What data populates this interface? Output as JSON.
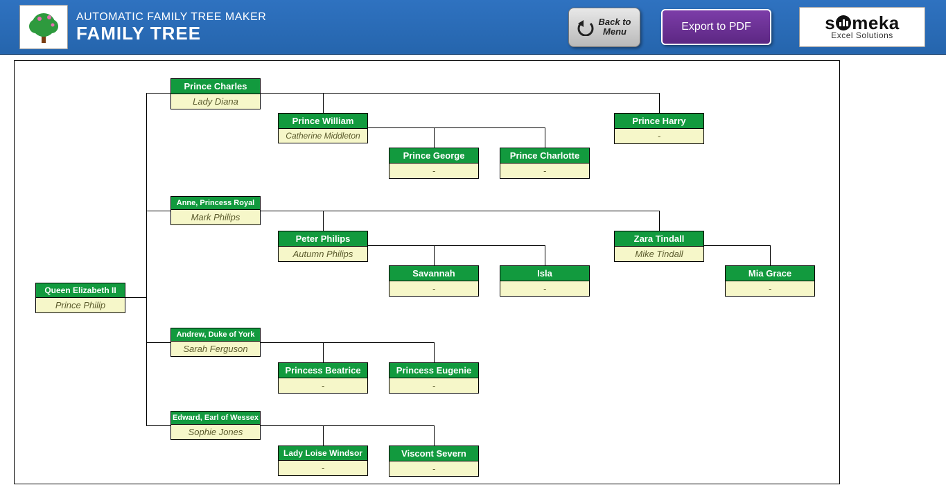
{
  "header": {
    "subtitle": "AUTOMATIC FAMILY TREE MAKER",
    "title": "FAMILY TREE",
    "back_label": "Back to Menu",
    "export_label": "Export to PDF",
    "logo_brand": "someka",
    "logo_sub": "Excel Solutions"
  },
  "nodes": {
    "root": {
      "name": "Queen Elizabeth II",
      "spouse": "Prince Philip"
    },
    "charles": {
      "name": "Prince Charles",
      "spouse": "Lady Diana"
    },
    "william": {
      "name": "Prince William",
      "spouse": "Catherine Middleton"
    },
    "george": {
      "name": "Prince George",
      "spouse": "-"
    },
    "charlotte": {
      "name": "Prince Charlotte",
      "spouse": "-"
    },
    "harry": {
      "name": "Prince Harry",
      "spouse": "-"
    },
    "anne": {
      "name": "Anne, Princess Royal",
      "spouse": "Mark Philips"
    },
    "peter": {
      "name": "Peter Philips",
      "spouse": "Autumn Philips"
    },
    "savannah": {
      "name": "Savannah",
      "spouse": "-"
    },
    "isla": {
      "name": "Isla",
      "spouse": "-"
    },
    "zara": {
      "name": "Zara Tindall",
      "spouse": "Mike Tindall"
    },
    "mia": {
      "name": "Mia Grace",
      "spouse": "-"
    },
    "andrew": {
      "name": "Andrew, Duke of York",
      "spouse": "Sarah Ferguson"
    },
    "beatrice": {
      "name": "Princess Beatrice",
      "spouse": "-"
    },
    "eugenie": {
      "name": "Princess Eugenie",
      "spouse": "-"
    },
    "edward": {
      "name": "Edward, Earl of Wessex",
      "spouse": "Sophie Jones"
    },
    "loise": {
      "name": "Lady Loise Windsor",
      "spouse": "-"
    },
    "severn": {
      "name": "Viscont Severn",
      "spouse": "-"
    }
  }
}
